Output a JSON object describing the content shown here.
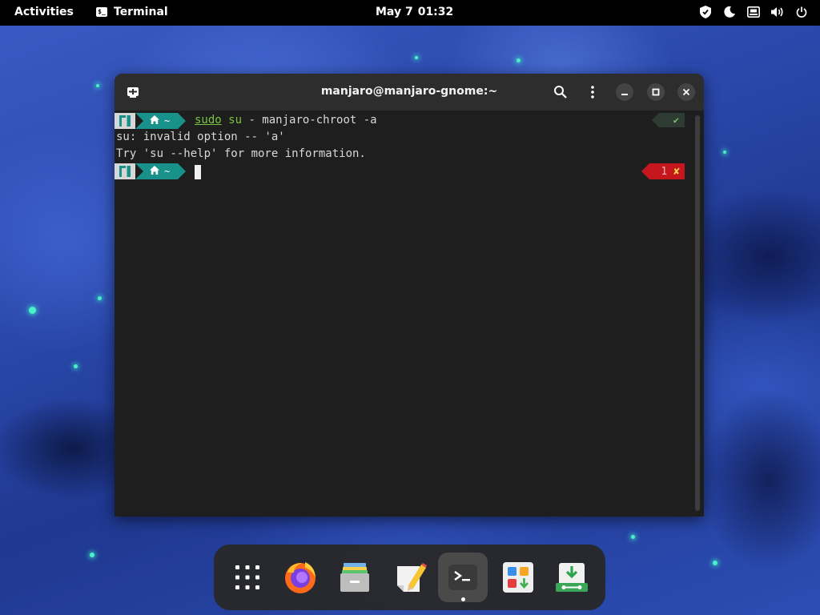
{
  "topbar": {
    "activities": "Activities",
    "app_menu": "Terminal",
    "clock": {
      "date": "May 7",
      "time": "01:32"
    },
    "tray_icons": [
      "vpn-shield-icon",
      "night-light-icon",
      "network-wired-icon",
      "volume-icon",
      "power-icon"
    ]
  },
  "window": {
    "title": "manjaro@manjaro-gnome:~",
    "buttons": [
      "new-tab-icon",
      "search-icon",
      "menu-icon",
      "minimize-icon",
      "maximize-icon",
      "close-icon"
    ]
  },
  "terminal": {
    "prompt_home": "~",
    "command": {
      "sudo": "sudo",
      "su": "su",
      "rest": " - manjaro-chroot -a"
    },
    "output": [
      "su: invalid option -- 'a'",
      "Try 'su --help' for more information."
    ],
    "status_ok": "✔",
    "status_err_code": "1",
    "status_err_mark": "✘"
  },
  "dock": {
    "items": [
      "app-grid-icon",
      "firefox-icon",
      "files-icon",
      "text-editor-icon",
      "terminal-icon",
      "software-icon",
      "installer-icon"
    ],
    "active_item": "terminal-icon"
  },
  "colors": {
    "prompt_teal": "#17918a",
    "command_green": "#7bc33e",
    "error_red": "#c4161c",
    "topbar": "#000000"
  }
}
